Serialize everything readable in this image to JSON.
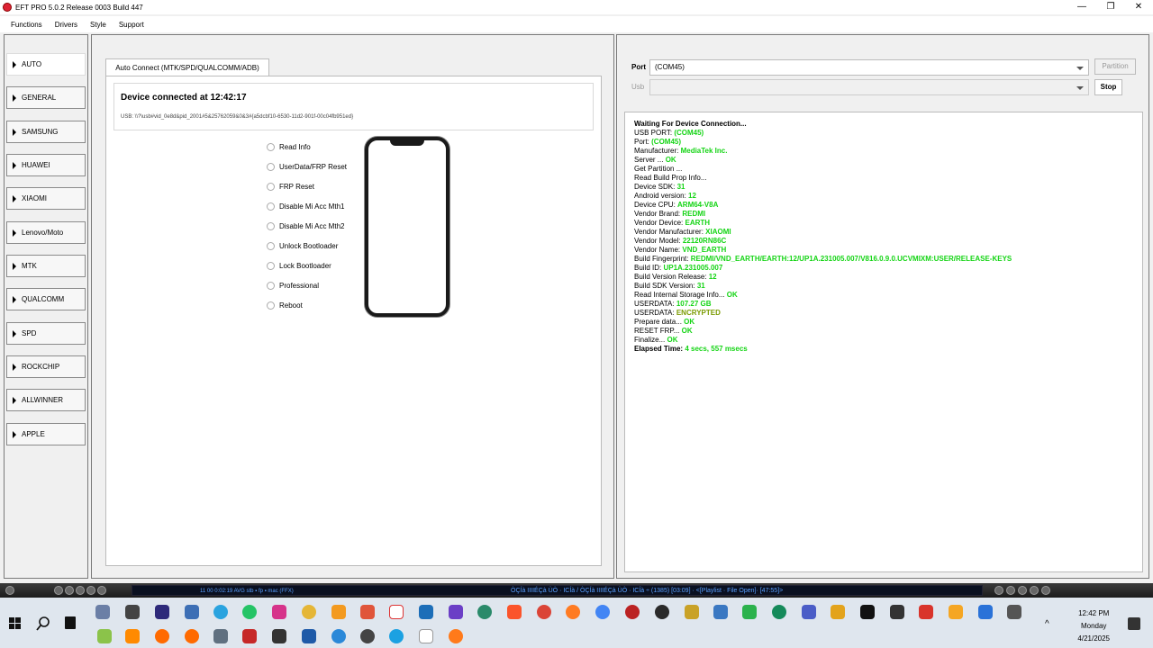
{
  "window": {
    "title": "EFT PRO 5.0.2 Release 0003 Build 447",
    "minimize": "—",
    "maximize": "❐",
    "close": "✕"
  },
  "menu": [
    "Functions",
    "Drivers",
    "Style",
    "Support"
  ],
  "sidebar": {
    "items": [
      "AUTO",
      "GENERAL",
      "SAMSUNG",
      "HUAWEI",
      "XIAOMI",
      "Lenovo/Moto",
      "MTK",
      "QUALCOMM",
      "SPD",
      "ROCKCHIP",
      "ALLWINNER",
      "APPLE"
    ],
    "active": "AUTO"
  },
  "center": {
    "tab_label": "Auto Connect (MTK/SPD/QUALCOMM/ADB)",
    "connection_status": "Device connected at 12:42:17",
    "usb_path": "USB: \\\\?\\usb#vid_0e8d&pid_2001#5&25762059&0&3#{a5dcbf10-6530-11d2-901f-00c04fb951ed}",
    "options": [
      "Read Info",
      "UserData/FRP Reset",
      "FRP Reset",
      "Disable Mi Acc Mth1",
      "Disable Mi Acc Mth2",
      "Unlock Bootloader",
      "Lock Bootloader",
      "Professional",
      "Reboot"
    ]
  },
  "right": {
    "port_label": "Port",
    "port_value": "(COM45)",
    "usb_label": "Usb",
    "usb_value": "",
    "partition_button": "Partition",
    "stop_button": "Stop",
    "log": [
      {
        "k": "Waiting For Device Connection...",
        "v": "",
        "head": true
      },
      {
        "k": "USB PORT: ",
        "v": "(COM45)"
      },
      {
        "k": "Port: ",
        "v": "(COM45)"
      },
      {
        "k": "Manufacturer: ",
        "v": "MediaTek Inc."
      },
      {
        "k": "Server ... ",
        "v": "OK"
      },
      {
        "k": "Get Partition ...",
        "v": ""
      },
      {
        "k": "Read Build Prop Info...",
        "v": ""
      },
      {
        "k": " Device SDK: ",
        "v": "31"
      },
      {
        "k": " Android version: ",
        "v": "12"
      },
      {
        "k": " Device CPU: ",
        "v": "ARM64-V8A"
      },
      {
        "k": " Vendor Brand: ",
        "v": "REDMI"
      },
      {
        "k": " Vendor Device: ",
        "v": "EARTH"
      },
      {
        "k": " Vendor Manufacturer: ",
        "v": "XIAOMI"
      },
      {
        "k": " Vendor Model: ",
        "v": "22120RN86C"
      },
      {
        "k": " Vendor Name: ",
        "v": "VND_EARTH"
      },
      {
        "k": " Build Fingerprint: ",
        "v": "REDMI/VND_EARTH/EARTH:12/UP1A.231005.007/V816.0.9.0.UCVMIXM:USER/RELEASE-KEYS"
      },
      {
        "k": " Build ID: ",
        "v": "UP1A.231005.007"
      },
      {
        "k": " Build Version Release: ",
        "v": "12"
      },
      {
        "k": " Build SDK Version: ",
        "v": "31"
      },
      {
        "k": "Read Internal Storage Info... ",
        "v": "OK"
      },
      {
        "k": "USERDATA: ",
        "v": "107.27 GB"
      },
      {
        "k": "USERDATA: ",
        "v": "ENCRYPTED",
        "olive": true
      },
      {
        "k": "Prepare data... ",
        "v": "OK"
      },
      {
        "k": "RESET FRP... ",
        "v": "OK"
      },
      {
        "k": "Finalize... ",
        "v": "OK"
      },
      {
        "k": "Elapsed Time: ",
        "v": "4 secs, 557 msecs",
        "head": true
      }
    ]
  },
  "player": {
    "time": "11    00    0:02:19    AVG stb ▪ fp ▪ mac (FFX)",
    "track": "ÒÇÍà IIIIÉÇà ÙÒ · ICÍà / ÒÇÍà IIIIÉÇà ÙÒ · ICÍà ÷ (1385) [03:09] · <[Playlist · File Open]· [47:55]>"
  },
  "taskbar": {
    "time": "12:42 PM",
    "day": "Monday",
    "date": "4/21/2025"
  }
}
